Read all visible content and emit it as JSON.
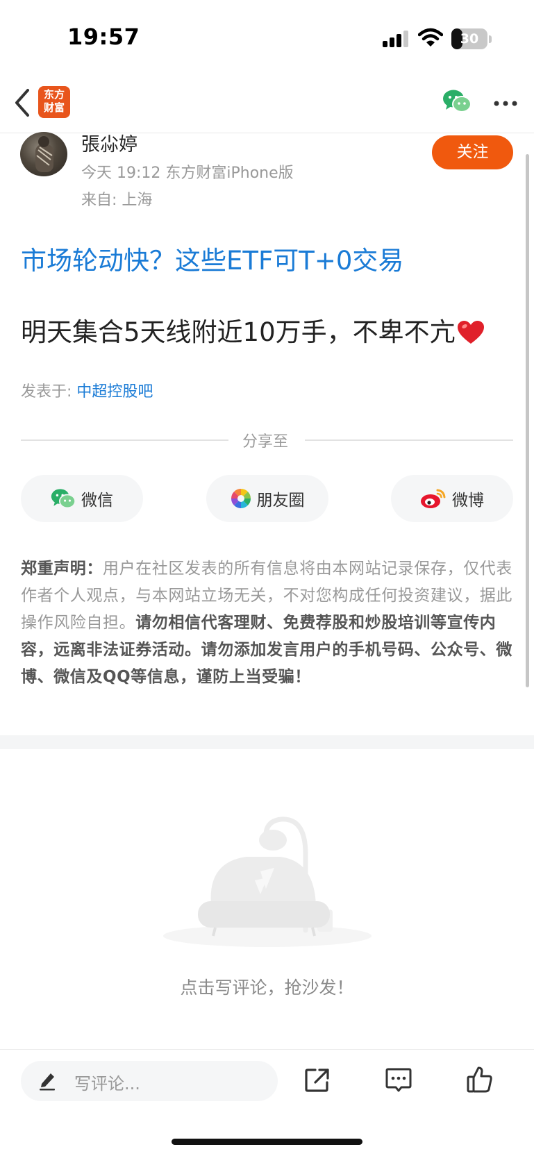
{
  "status_bar": {
    "time": "19:57",
    "battery": "30",
    "battery_level": 0.3
  },
  "nav": {
    "logo_line1": "东方",
    "logo_line2": "财富"
  },
  "author": {
    "name": "張尛婷",
    "meta": "今天 19:12 东方财富iPhone版",
    "location": "来自: 上海",
    "follow_label": "关注"
  },
  "post": {
    "ad_title": "市场轮动快？这些ETF可T+0交易",
    "body": "明天集合5天线附近10万手，不卑不亢",
    "posted_in_label": "发表于:",
    "bar_name": "中超控股吧"
  },
  "share": {
    "label": "分享至",
    "buttons": [
      {
        "label": "微信",
        "icon": "wechat-icon"
      },
      {
        "label": "朋友圈",
        "icon": "moments-icon"
      },
      {
        "label": "微博",
        "icon": "weibo-icon"
      }
    ]
  },
  "disclaimer": {
    "title": "郑重声明：",
    "part1": "用户在社区发表的所有信息将由本网站记录保存，仅代表作者个人观点，与本网站立场无关，不对您构成任何投资建议，据此操作风险自担。",
    "part2": "请勿相信代客理财、免费荐股和炒股培训等宣传内容，远离非法证券活动。请勿添加发言用户的手机号码、公众号、微博、微信及QQ等信息，谨防上当受骗！"
  },
  "comments": {
    "empty_text": "点击写评论，抢沙发！"
  },
  "bottom_bar": {
    "comment_placeholder": "写评论..."
  },
  "colors": {
    "accent": "#f0590e",
    "link": "#1a7bd6",
    "wechat": "#2aae67"
  }
}
